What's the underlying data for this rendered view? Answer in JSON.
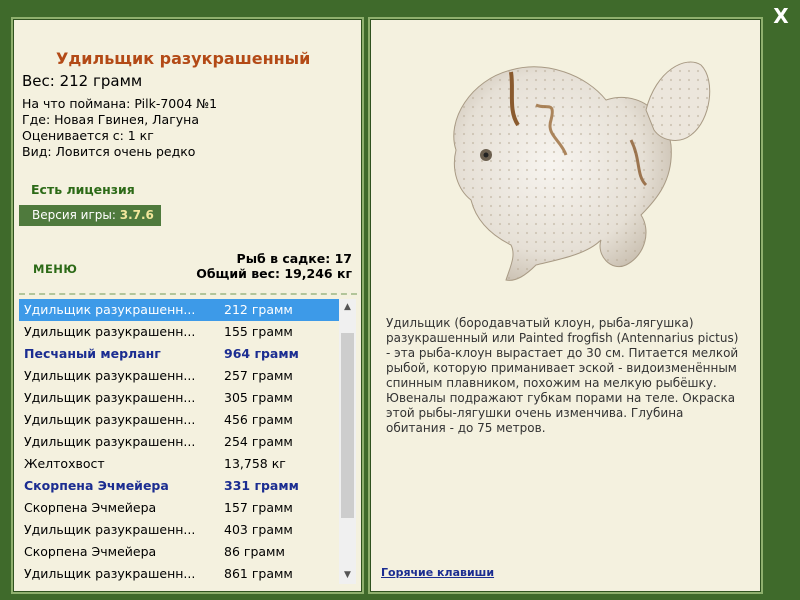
{
  "close_label": "X",
  "fish": {
    "title": "Удильщик разукрашенный",
    "weight": "Вес: 212 грамм",
    "bait": "На что поймана: Pilk-7004 №1",
    "place": "Где: Новая Гвинея, Лагуна",
    "min_weight": "Оценивается с: 1 кг",
    "rarity": "Вид: Ловится очень редко"
  },
  "license": "Есть лицензия",
  "version": {
    "label": "Версия игры:",
    "value": "3.7.6"
  },
  "menu_label": "МЕНЮ",
  "stats": {
    "count": "Рыб в садке: 17",
    "total": "Общий вес: 19,246 кг"
  },
  "catch_list": [
    {
      "name": "Удильщик разукрашенн...",
      "weight": "212 грамм",
      "selected": true,
      "rare": false
    },
    {
      "name": "Удильщик разукрашенн...",
      "weight": "155 грамм",
      "selected": false,
      "rare": false
    },
    {
      "name": "Песчаный мерланг",
      "weight": "964 грамм",
      "selected": false,
      "rare": true
    },
    {
      "name": "Удильщик разукрашенн...",
      "weight": "257 грамм",
      "selected": false,
      "rare": false
    },
    {
      "name": "Удильщик разукрашенн...",
      "weight": "305 грамм",
      "selected": false,
      "rare": false
    },
    {
      "name": "Удильщик разукрашенн...",
      "weight": "456 грамм",
      "selected": false,
      "rare": false
    },
    {
      "name": "Удильщик разукрашенн...",
      "weight": "254 грамм",
      "selected": false,
      "rare": false
    },
    {
      "name": "Желтохвост",
      "weight": "13,758 кг",
      "selected": false,
      "rare": false
    },
    {
      "name": "Скорпена Эчмейера",
      "weight": "331 грамм",
      "selected": false,
      "rare": true
    },
    {
      "name": "Скорпена Эчмейера",
      "weight": "157 грамм",
      "selected": false,
      "rare": false
    },
    {
      "name": "Удильщик разукрашенн...",
      "weight": "403 грамм",
      "selected": false,
      "rare": false
    },
    {
      "name": "Скорпена Эчмейера",
      "weight": "86 грамм",
      "selected": false,
      "rare": false
    },
    {
      "name": "Удильщик разукрашенн...",
      "weight": "861 грамм",
      "selected": false,
      "rare": false
    }
  ],
  "description": "Удильщик (бородавчатый клоун, рыба-лягушка) разукрашенный или Painted frogfish (Antennarius pictus) - эта рыба-клоун вырастает до 30 см. Питается мелкой рыбой, которую приманивает эской - видоизменённым спинным плавником, похожим на мелкую рыбёшку. Ювеналы подражают губкам порами на теле. Окраска этой рыбы-лягушки очень изменчива. Глубина обитания - до 75 метров.",
  "hotkeys_label": "Горячие клавиши",
  "colors": {
    "background": "#3f6a2b",
    "panel": "#f4f1df",
    "title": "#b34a16",
    "license": "#2c6a17",
    "rare": "#1b2d91",
    "selected": "#3d9ae8"
  },
  "icons": {
    "close": "close-icon",
    "scroll_up": "arrow-up-icon",
    "scroll_down": "arrow-down-icon"
  }
}
